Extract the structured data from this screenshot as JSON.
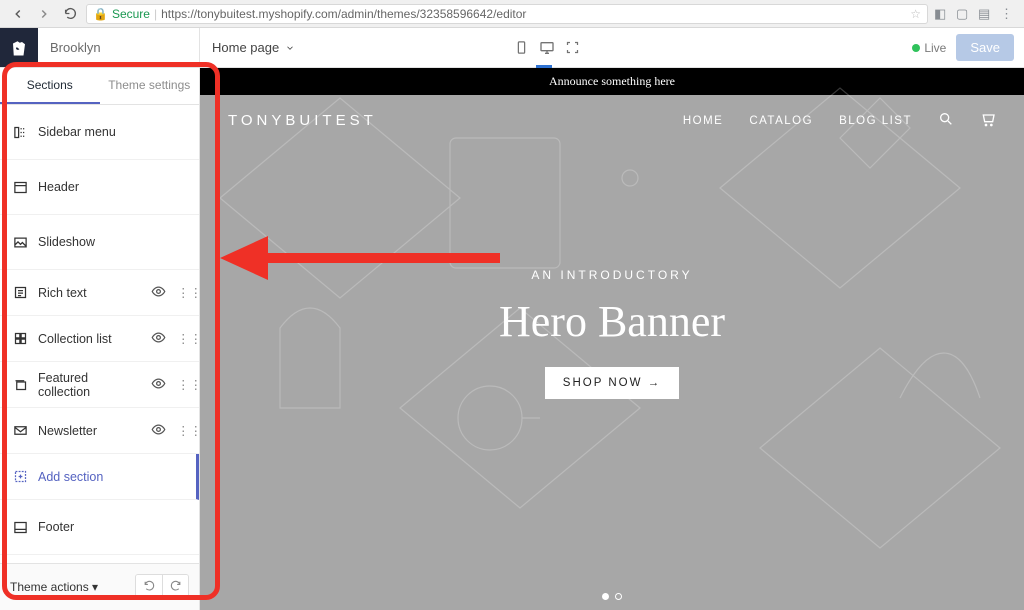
{
  "url": {
    "secure": "Secure",
    "full": "https://tonybuitest.myshopify.com/admin/themes/32358596642/editor"
  },
  "theme_name": "Brooklyn",
  "page_selector": "Home page",
  "status": {
    "live": "Live",
    "save": "Save"
  },
  "sidebar": {
    "tabs": [
      "Sections",
      "Theme settings"
    ],
    "items": [
      {
        "label": "Sidebar menu",
        "icon": "sidebar-icon",
        "eye": false,
        "grip": false
      },
      {
        "label": "Header",
        "icon": "header-icon",
        "eye": false,
        "grip": false
      },
      {
        "label": "Slideshow",
        "icon": "image-icon",
        "eye": false,
        "grip": false
      },
      {
        "label": "Rich text",
        "icon": "text-icon",
        "eye": true,
        "grip": true
      },
      {
        "label": "Collection list",
        "icon": "grid-icon",
        "eye": true,
        "grip": true
      },
      {
        "label": "Featured collection",
        "icon": "stack-icon",
        "eye": true,
        "grip": true
      },
      {
        "label": "Newsletter",
        "icon": "mail-icon",
        "eye": true,
        "grip": true
      },
      {
        "label": "Add section",
        "icon": "plus-icon",
        "eye": false,
        "grip": false,
        "active": true
      },
      {
        "label": "Footer",
        "icon": "footer-icon",
        "eye": false,
        "grip": false
      }
    ],
    "theme_actions": "Theme actions"
  },
  "preview": {
    "announce": "Announce something here",
    "site_title": "TONYBUITEST",
    "nav": [
      "HOME",
      "CATALOG",
      "BLOG LIST"
    ],
    "hero_kicker": "AN INTRODUCTORY",
    "hero_title": "Hero Banner",
    "hero_button": "SHOP NOW →"
  }
}
